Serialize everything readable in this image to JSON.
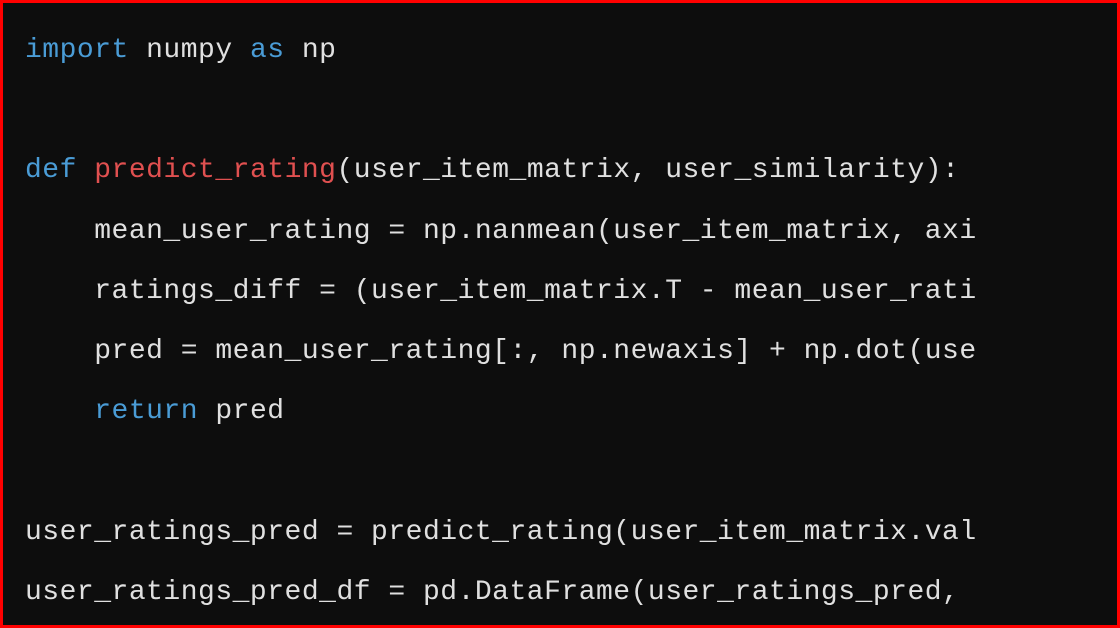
{
  "code": {
    "line1": {
      "keyword_import": "import",
      "module": " numpy ",
      "keyword_as": "as",
      "alias": " np"
    },
    "line2": "",
    "line3": {
      "keyword_def": "def",
      "space1": " ",
      "funcname": "predict_rating",
      "params": "(user_item_matrix, user_similarity):"
    },
    "line4": "    mean_user_rating = np.nanmean(user_item_matrix, axi",
    "line5": "    ratings_diff = (user_item_matrix.T - mean_user_rati",
    "line6": "    pred = mean_user_rating[:, np.newaxis] + np.dot(use",
    "line7": {
      "indent": "    ",
      "keyword_return": "return",
      "rest": " pred"
    },
    "line8": "",
    "line9": "user_ratings_pred = predict_rating(user_item_matrix.val",
    "line10": "user_ratings_pred_df = pd.DataFrame(user_ratings_pred, "
  }
}
